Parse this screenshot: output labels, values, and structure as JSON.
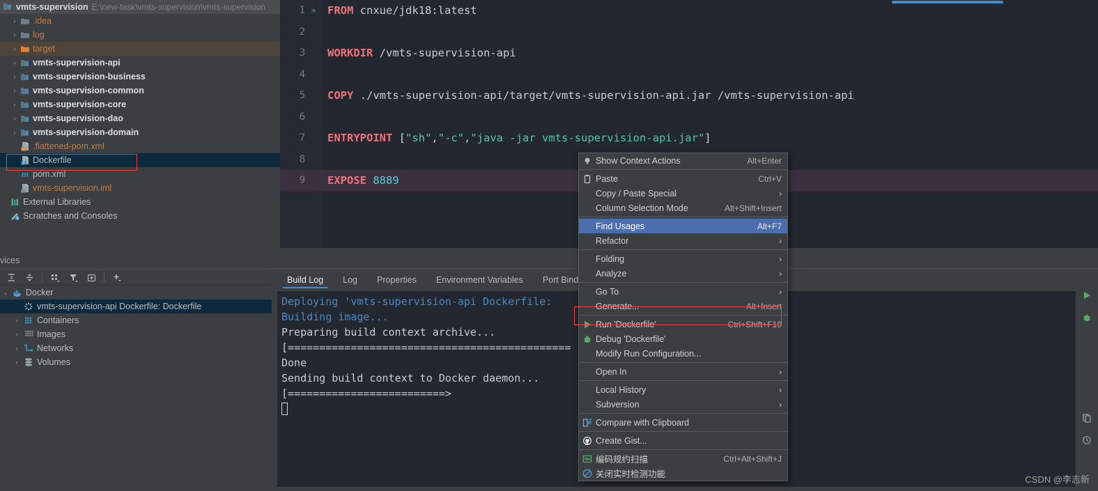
{
  "project": {
    "name": "vmts-supervision",
    "path": "E:\\new-task\\vmts-supervision\\vmts-supervision",
    "tree": [
      {
        "label": ".idea",
        "icon": "folder-icon",
        "arrow": "›",
        "indent": 2,
        "style": "orange"
      },
      {
        "label": "log",
        "icon": "folder-icon",
        "arrow": "›",
        "indent": 2,
        "style": "orange"
      },
      {
        "label": "target",
        "icon": "folder-orange-icon",
        "arrow": "›",
        "indent": 2,
        "style": "orange",
        "row": "target"
      },
      {
        "label": "vmts-supervision-api",
        "icon": "module-icon",
        "arrow": "›",
        "indent": 2,
        "style": "bold"
      },
      {
        "label": "vmts-supervision-business",
        "icon": "module-icon",
        "arrow": "›",
        "indent": 2,
        "style": "bold"
      },
      {
        "label": "vmts-supervision-common",
        "icon": "module-icon",
        "arrow": "›",
        "indent": 2,
        "style": "bold"
      },
      {
        "label": "vmts-supervision-core",
        "icon": "module-icon",
        "arrow": "›",
        "indent": 2,
        "style": "bold"
      },
      {
        "label": "vmts-supervision-dao",
        "icon": "module-icon",
        "arrow": "›",
        "indent": 2,
        "style": "bold"
      },
      {
        "label": "vmts-supervision-domain",
        "icon": "module-icon",
        "arrow": "›",
        "indent": 2,
        "style": "bold"
      },
      {
        "label": ".flattened-pom.xml",
        "icon": "xml-file-icon",
        "arrow": "",
        "indent": 2,
        "style": "orange"
      },
      {
        "label": "Dockerfile",
        "icon": "dockerfile-icon",
        "arrow": "",
        "indent": 2,
        "style": "plain",
        "row": "selected"
      },
      {
        "label": "pom.xml",
        "icon": "maven-icon",
        "arrow": "",
        "indent": 2,
        "style": "plain"
      },
      {
        "label": "vmts-supervision.iml",
        "icon": "iml-file-icon",
        "arrow": "",
        "indent": 2,
        "style": "orange"
      },
      {
        "label": "External Libraries",
        "icon": "libraries-icon",
        "arrow": "",
        "indent": 1,
        "style": "plain"
      },
      {
        "label": "Scratches and Consoles",
        "icon": "scratches-icon",
        "arrow": "",
        "indent": 1,
        "style": "plain"
      }
    ]
  },
  "editor": {
    "lines": [
      {
        "n": "1",
        "gutter_run": "»",
        "tokens": [
          {
            "t": "FROM",
            "c": "kw"
          },
          {
            "t": " cnxue/jdk18:latest",
            "c": "plain"
          }
        ]
      },
      {
        "n": "2",
        "gutter_run": "",
        "tokens": []
      },
      {
        "n": "3",
        "gutter_run": "",
        "tokens": [
          {
            "t": "WORKDIR",
            "c": "kw"
          },
          {
            "t": " /vmts-supervision-api",
            "c": "plain"
          }
        ]
      },
      {
        "n": "4",
        "gutter_run": "",
        "tokens": []
      },
      {
        "n": "5",
        "gutter_run": "",
        "tokens": [
          {
            "t": "COPY",
            "c": "kw"
          },
          {
            "t": " ./vmts-supervision-api/target/vmts-supervision-api.jar /vmts-supervision-api",
            "c": "plain"
          }
        ]
      },
      {
        "n": "6",
        "gutter_run": "",
        "tokens": []
      },
      {
        "n": "7",
        "gutter_run": "",
        "tokens": [
          {
            "t": "ENTRYPOINT",
            "c": "kw"
          },
          {
            "t": " [",
            "c": "plain"
          },
          {
            "t": "\"sh\"",
            "c": "str"
          },
          {
            "t": ",",
            "c": "plain"
          },
          {
            "t": "\"-c\"",
            "c": "str"
          },
          {
            "t": ",",
            "c": "plain"
          },
          {
            "t": "\"java -jar vmts-supervision-api.jar\"",
            "c": "str"
          },
          {
            "t": "]",
            "c": "plain"
          }
        ]
      },
      {
        "n": "8",
        "gutter_run": "",
        "tokens": []
      },
      {
        "n": "9",
        "gutter_run": "",
        "current": true,
        "tokens": [
          {
            "t": "EXPOSE",
            "c": "kw"
          },
          {
            "t": " ",
            "c": "plain"
          },
          {
            "t": "8889",
            "c": "num"
          }
        ]
      }
    ]
  },
  "context_menu": {
    "items": [
      {
        "label": "Show Context Actions",
        "shortcut": "Alt+Enter",
        "icon": "lightbulb-icon",
        "mnemonic": ""
      },
      {
        "sep": true
      },
      {
        "label": "Paste",
        "shortcut": "Ctrl+V",
        "icon": "clipboard-icon",
        "mnemonic": "P"
      },
      {
        "label": "Copy / Paste Special",
        "shortcut": "",
        "icon": "",
        "submenu": true
      },
      {
        "label": "Column Selection Mode",
        "shortcut": "Alt+Shift+Insert",
        "icon": "",
        "mnemonic": "M"
      },
      {
        "sep": true
      },
      {
        "label": "Find Usages",
        "shortcut": "Alt+F7",
        "icon": "",
        "mnemonic": "U",
        "selected": true
      },
      {
        "label": "Refactor",
        "shortcut": "",
        "icon": "",
        "submenu": true,
        "mnemonic": "R"
      },
      {
        "sep": true
      },
      {
        "label": "Folding",
        "shortcut": "",
        "icon": "",
        "submenu": true
      },
      {
        "label": "Analyze",
        "shortcut": "",
        "icon": "",
        "submenu": true,
        "mnemonic": "z"
      },
      {
        "sep": true
      },
      {
        "label": "Go To",
        "shortcut": "",
        "icon": "",
        "submenu": true
      },
      {
        "label": "Generate...",
        "shortcut": "Alt+Insert",
        "icon": "",
        "mnemonic": ""
      },
      {
        "sep": true
      },
      {
        "label": "Run 'Dockerfile'",
        "shortcut": "Ctrl+Shift+F10",
        "icon": "run-green-arrow-icon",
        "mnemonic": "u",
        "highlighted": true
      },
      {
        "label": "Debug 'Dockerfile'",
        "shortcut": "",
        "icon": "debug-bug-icon",
        "mnemonic": "D"
      },
      {
        "label": "Modify Run Configuration...",
        "shortcut": "",
        "icon": ""
      },
      {
        "sep": true
      },
      {
        "label": "Open In",
        "shortcut": "",
        "icon": "",
        "submenu": true
      },
      {
        "sep": true
      },
      {
        "label": "Local History",
        "shortcut": "",
        "icon": "",
        "submenu": true,
        "mnemonic": "H"
      },
      {
        "label": "Subversion",
        "shortcut": "",
        "icon": "",
        "submenu": true,
        "mnemonic": "S"
      },
      {
        "sep": true
      },
      {
        "label": "Compare with Clipboard",
        "shortcut": "",
        "icon": "compare-icon",
        "mnemonic": "b"
      },
      {
        "sep": true
      },
      {
        "label": "Create Gist...",
        "shortcut": "",
        "icon": "github-icon"
      },
      {
        "sep": true
      },
      {
        "label": "编码规约扫描",
        "shortcut": "Ctrl+Alt+Shift+J",
        "icon": "scan-icon"
      },
      {
        "label": "关闭实时检测功能",
        "shortcut": "",
        "icon": "disable-icon"
      }
    ]
  },
  "services": {
    "title": "vices",
    "toolbar": [
      {
        "name": "expand-all-icon"
      },
      {
        "name": "collapse-all-icon"
      },
      {
        "name": "group-by-icon"
      },
      {
        "name": "filter-icon"
      },
      {
        "name": "add-frame-icon"
      },
      {
        "name": "add-service-icon"
      }
    ],
    "tree": [
      {
        "label": "Docker",
        "icon": "docker-icon",
        "arrow": "⌄",
        "indent": 1
      },
      {
        "label": "vmts-supervision-api Dockerfile: Dockerfile",
        "icon": "spinner-icon",
        "arrow": "",
        "indent": 2,
        "selected": true
      },
      {
        "label": "Containers",
        "icon": "containers-icon",
        "arrow": "›",
        "indent": 2
      },
      {
        "label": "Images",
        "icon": "images-icon",
        "arrow": "›",
        "indent": 2
      },
      {
        "label": "Networks",
        "icon": "networks-icon",
        "arrow": "›",
        "indent": 2
      },
      {
        "label": "Volumes",
        "icon": "volumes-icon",
        "arrow": "›",
        "indent": 2
      }
    ]
  },
  "build_log": {
    "tabs": [
      {
        "label": "Build Log",
        "active": true
      },
      {
        "label": "Log",
        "active": false
      },
      {
        "label": "Properties",
        "active": false
      },
      {
        "label": "Environment Variables",
        "active": false
      },
      {
        "label": "Port Bindi",
        "active": false
      }
    ],
    "console_lines": [
      {
        "text": "Deploying 'vmts-supervision-api Dockerfile:",
        "color": "blue"
      },
      {
        "text": "Building image...",
        "color": "blue"
      },
      {
        "text": "Preparing build context archive...",
        "color": "plain"
      },
      {
        "text": "[=============================================",
        "color": "plain"
      },
      {
        "text": "Done",
        "color": "plain"
      },
      {
        "text": "",
        "color": "plain"
      },
      {
        "text": "Sending build context to Docker daemon...",
        "color": "plain"
      },
      {
        "text": "[=========================>",
        "color": "plain"
      },
      {
        "text": "",
        "color": "plain",
        "cursor": true
      }
    ],
    "side_actions": [
      {
        "name": "rerun-green-arrow-icon"
      },
      {
        "name": "debug-bug-icon"
      },
      {
        "name": "copy-icon"
      },
      {
        "name": "history-icon"
      }
    ]
  },
  "watermark": {
    "text": "CSDN @李志新"
  },
  "colors": {
    "accent_blue": "#4a88c7",
    "menu_selection": "#4b6eaf",
    "tree_selection": "#0d293e",
    "highlight_box": "#e84444",
    "keyword_red": "#f07178",
    "string_green": "#4ec9a0",
    "number_cyan": "#4fd0d8",
    "panel_bg": "#3c3f41",
    "editor_bg": "#232730"
  }
}
